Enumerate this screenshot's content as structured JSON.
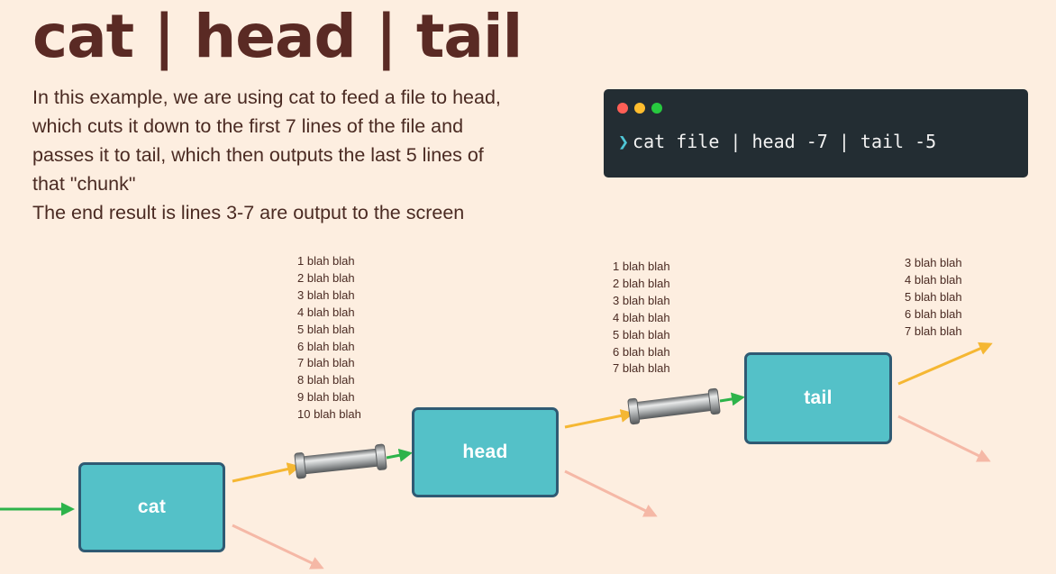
{
  "title": "cat | head | tail",
  "description": [
    "In this example, we are using cat to feed a file to head,",
    "which cuts it down to the first 7 lines of the file and",
    "passes it to tail, which then outputs the last 5 lines of",
    "that \"chunk\""
  ],
  "result_note": "The end result is lines 3-7 are output to the screen",
  "terminal": {
    "prompt": "❯",
    "command": "cat file | head -7 | tail -5",
    "dots": [
      "#ff5f56",
      "#ffbd2e",
      "#27c93f"
    ]
  },
  "boxes": {
    "cat": "cat",
    "head": "head",
    "tail": "tail"
  },
  "streams": {
    "cat_output": [
      "1 blah blah",
      "2 blah blah",
      "3 blah blah",
      "4 blah blah",
      "5 blah blah",
      "6 blah blah",
      "7 blah blah",
      "8 blah blah",
      "9 blah blah",
      "10 blah blah"
    ],
    "head_output": [
      "1 blah blah",
      "2 blah blah",
      "3 blah blah",
      "4 blah blah",
      "5 blah blah",
      "6 blah blah",
      "7 blah blah"
    ],
    "tail_output": [
      "3 blah blah",
      "4 blah blah",
      "5 blah blah",
      "6 blah blah",
      "7 blah blah"
    ]
  },
  "colors": {
    "background": "#fdeee0",
    "title": "#5a2a24",
    "box_fill": "#54c1c8",
    "box_border": "#2f5a73",
    "stdin_arrow": "#2db34a",
    "stdout_arrow": "#f5b733",
    "stderr_arrow": "#f5b8a6",
    "terminal_bg": "#232d33"
  }
}
